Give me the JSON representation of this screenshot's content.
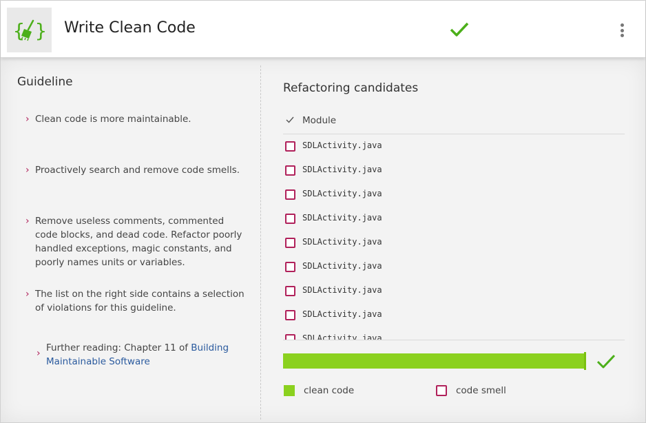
{
  "header": {
    "title": "Write Clean Code",
    "logo_icon": "broom-braces-icon",
    "status_icon": "checkmark-icon",
    "menu_icon": "more-vert-icon"
  },
  "guideline": {
    "title": "Guideline",
    "items": [
      "Clean code is more maintainable.",
      "Proactively search and remove code smells.",
      "Remove useless comments, commented code blocks, and dead code. Refactor poorly handled exceptions, magic constants, and poorly names units or variables.",
      "The list on the right side contains a selection of violations for this guideline."
    ],
    "further_prefix": "Further reading: Chapter 11 of ",
    "further_link": "Building Maintainable Software"
  },
  "refactoring": {
    "title": "Refactoring candidates",
    "column_header": "Module",
    "files": [
      "SDLActivity.java",
      "SDLActivity.java",
      "SDLActivity.java",
      "SDLActivity.java",
      "SDLActivity.java",
      "SDLActivity.java",
      "SDLActivity.java",
      "SDLActivity.java",
      "SDLActivity.java"
    ]
  },
  "progress": {
    "fraction": 1.0
  },
  "legend": {
    "clean_label": "clean code",
    "smell_label": "code smell"
  },
  "colors": {
    "accent_green": "#8bd11f",
    "check_green": "#4caf1a",
    "smell_magenta": "#b0205a",
    "link_blue": "#2a5a9e"
  }
}
